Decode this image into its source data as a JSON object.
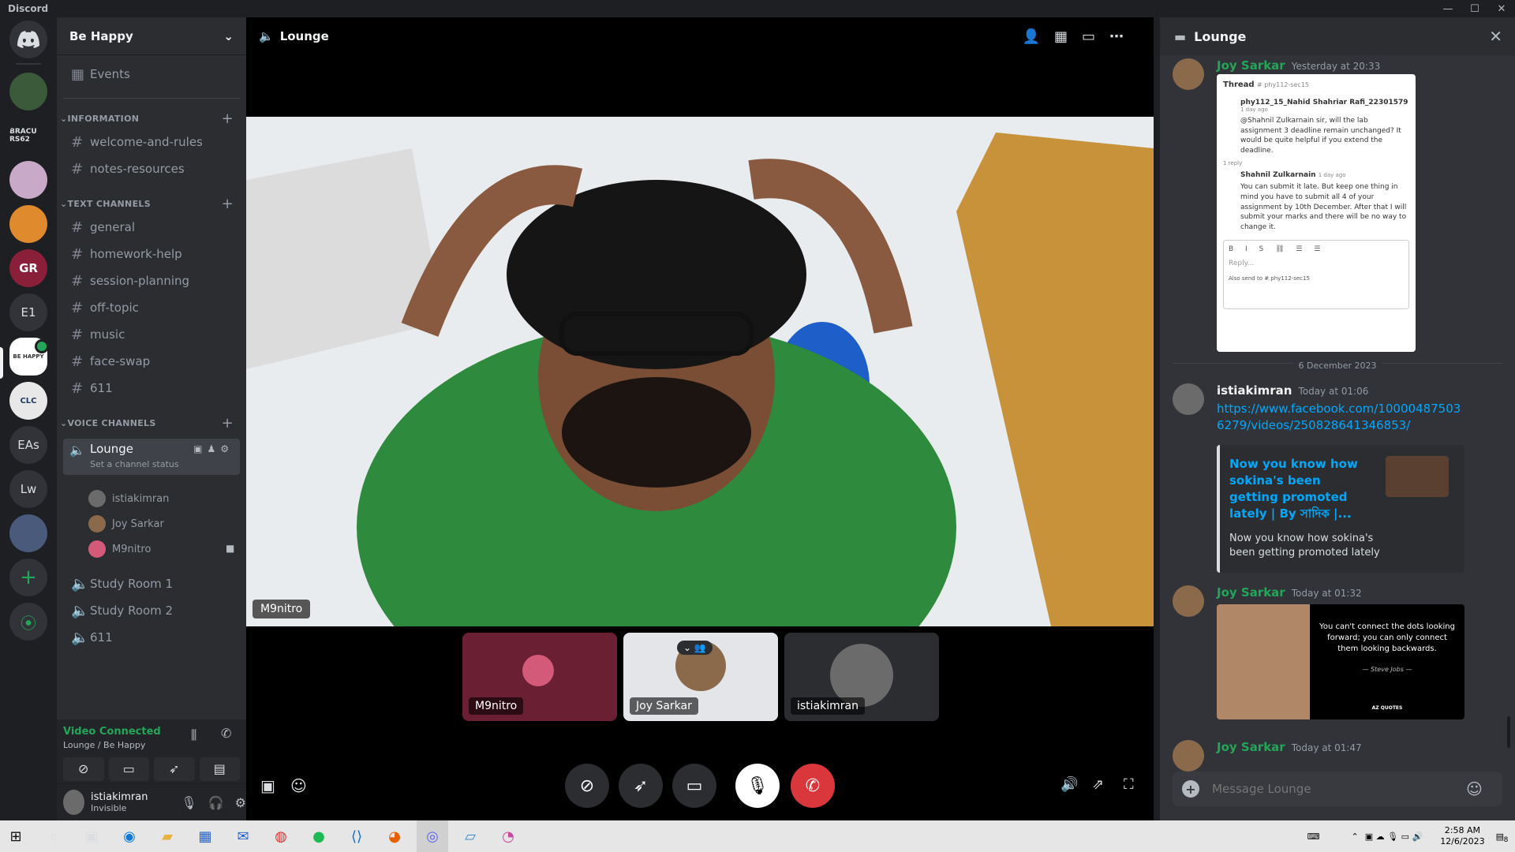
{
  "window": {
    "title": "Discord",
    "minimize": "—",
    "maximize": "☐",
    "close": "✕"
  },
  "guilds": [
    {
      "label": "",
      "color": "#404249"
    },
    {
      "label": "",
      "color": "#3a5a3a"
    },
    {
      "label": "BRACU RS62",
      "color": "#1e1f22"
    },
    {
      "label": "",
      "color": "#c9a9c8"
    },
    {
      "label": "",
      "color": "#e08a2e"
    },
    {
      "label": "GR",
      "color": "#8a1f3a"
    },
    {
      "label": "E1",
      "color": "#313338"
    },
    {
      "label": "BE HAPPY",
      "color": "#ffffff"
    },
    {
      "label": "CLC",
      "color": "#e8e8e8"
    },
    {
      "label": "EAs",
      "color": "#313338"
    },
    {
      "label": "Lw",
      "color": "#313338"
    },
    {
      "label": "",
      "color": "#4a5a7a"
    }
  ],
  "server": {
    "name": "Be Happy",
    "events": "Events",
    "categories": {
      "information": "INFORMATION",
      "text": "TEXT CHANNELS",
      "voice": "VOICE CHANNELS"
    },
    "info_channels": [
      "welcome-and-rules",
      "notes-resources"
    ],
    "text_channels": [
      "general",
      "homework-help",
      "session-planning",
      "off-topic",
      "music",
      "face-swap",
      "611"
    ],
    "voice": {
      "lounge": "Lounge",
      "lounge_status": "Set a channel status",
      "members": [
        "istiakimran",
        "Joy Sarkar",
        "M9nitro"
      ],
      "other": [
        "Study Room 1",
        "Study Room 2",
        "611"
      ]
    }
  },
  "vc_panel": {
    "status": "Video Connected",
    "location": "Lounge / Be Happy"
  },
  "user": {
    "name": "istiakimran",
    "status": "Invisible"
  },
  "stage": {
    "channel": "Lounge",
    "main_speaker": "M9nitro",
    "tiles": [
      "M9nitro",
      "Joy Sarkar",
      "istiakimran"
    ]
  },
  "chat": {
    "title": "Lounge",
    "messages": [
      {
        "author": "Joy Sarkar",
        "time": "Yesterday at 20:33",
        "color": "#23a55a"
      },
      {
        "author": "istiakimran",
        "time": "Today at 01:06",
        "color": "#f2f3f5"
      },
      {
        "author": "Joy Sarkar",
        "time": "Today at 01:32",
        "color": "#23a55a"
      },
      {
        "author": "Joy Sarkar",
        "time": "Today at 01:47",
        "color": "#23a55a"
      }
    ],
    "date_divider": "6 December 2023",
    "thread": {
      "title": "Thread",
      "channel": "# phy112-sec15",
      "post_author": "phy112_15_Nahid Shahriar Rafi_22301579",
      "post_time": "1 day ago",
      "post_text": "@Shahnil Zulkarnain sir, will the lab assignment 3 deadline remain unchanged? It would be quite helpful if you extend the deadline.",
      "reply_count": "1 reply",
      "reply_author": "Shahnil Zulkarnain",
      "reply_time": "1 day ago",
      "reply_text": "You can submit it late. But keep one thing in mind you have to submit all 4 of your assignment by 10th December. After that I will submit your marks and there will be no way to change it.",
      "reply_placeholder": "Reply...",
      "also_send": "Also send to # phy112-sec15"
    },
    "link": "https://www.facebook.com/100004875036279/videos/250828641346853/",
    "embed_title": "Now you know how sokina's been getting promoted lately | By সাদিক |...",
    "embed_desc": "Now you know how sokina's been getting promoted lately",
    "quote_text": "You can't connect the dots looking forward; you can only connect them looking backwards.",
    "quote_author": "— Steve Jobs —",
    "quote_brand": "AZ QUOTES",
    "input_placeholder": "Message Lounge"
  },
  "taskbar": {
    "time": "2:58 AM",
    "date": "12/6/2023",
    "notif": "8"
  }
}
